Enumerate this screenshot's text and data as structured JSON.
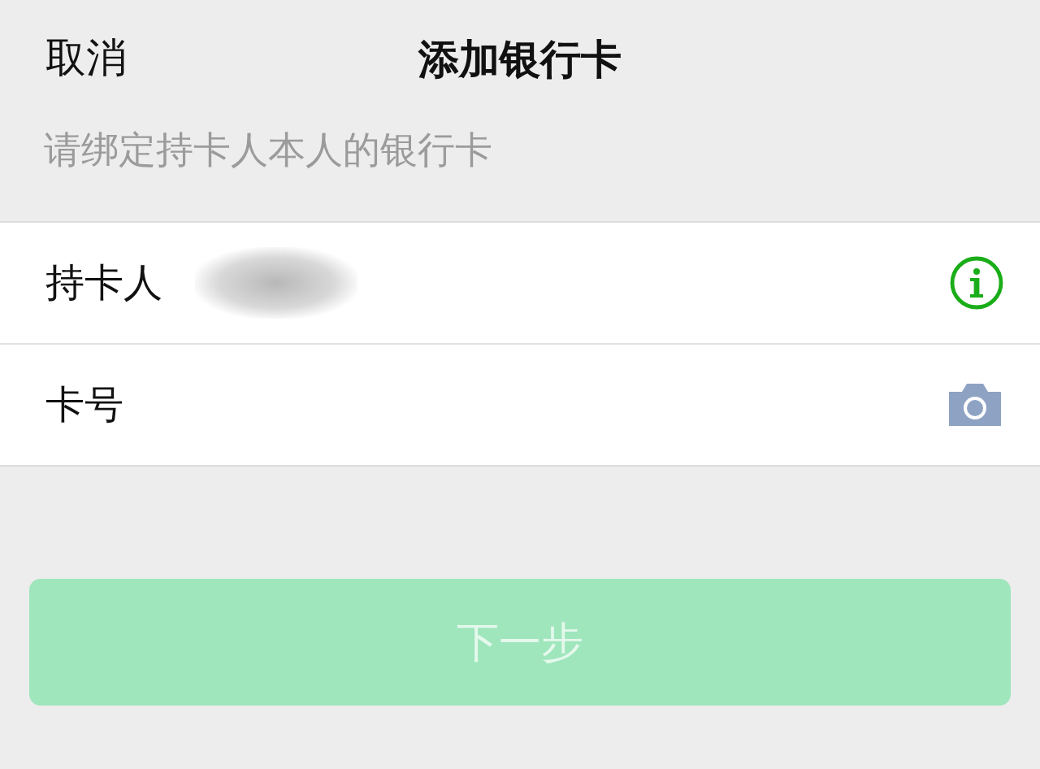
{
  "header": {
    "cancel": "取消",
    "title": "添加银行卡"
  },
  "hint": "请绑定持卡人本人的银行卡",
  "fields": [
    {
      "kind": "name",
      "label": "持卡人"
    },
    {
      "kind": "card",
      "label": "卡号"
    }
  ],
  "next_button": {
    "label": "下一步",
    "disabled": true
  }
}
